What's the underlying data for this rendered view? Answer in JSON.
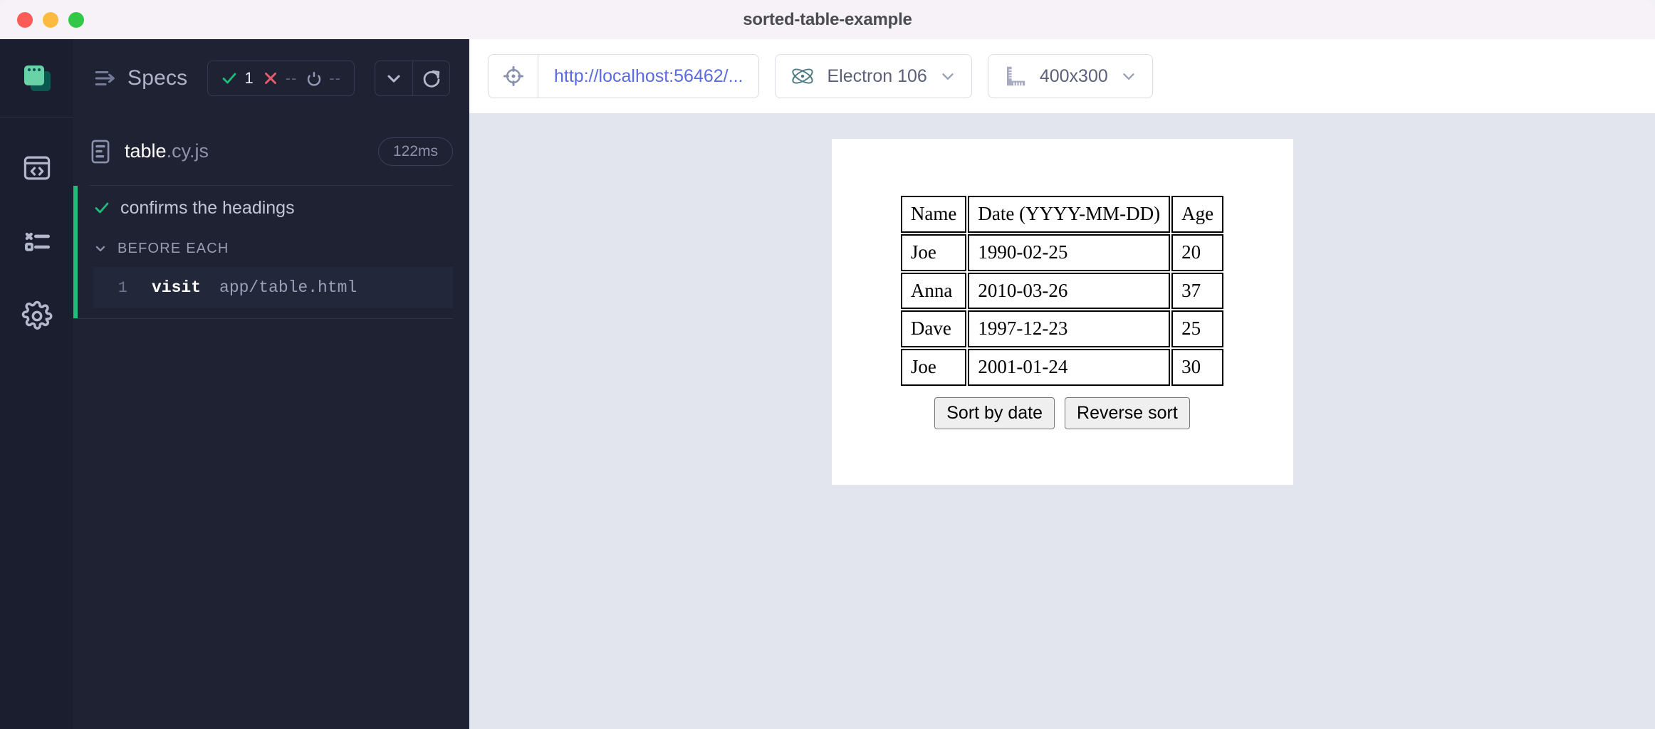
{
  "window": {
    "title": "sorted-table-example",
    "traffic_lights": [
      "close",
      "minimize",
      "zoom"
    ]
  },
  "rail": {
    "logo": "cypress-logo-icon",
    "items": [
      {
        "name": "specs-runner-icon",
        "icon": "browser-code-icon"
      },
      {
        "name": "test-results-icon",
        "icon": "checklist-icon"
      },
      {
        "name": "settings-icon",
        "icon": "gear-icon"
      }
    ]
  },
  "specs_panel": {
    "header_title": "Specs",
    "header_icon": "collapse-sidebar-icon",
    "stats": [
      {
        "icon": "check-icon",
        "value": "1",
        "color": "#1cbe79"
      },
      {
        "icon": "x-icon",
        "value": "--",
        "color": "#e45b6e"
      },
      {
        "icon": "pending-icon",
        "value": "--",
        "color": "#8e92ab"
      }
    ],
    "controls": [
      {
        "name": "chevron-down-button",
        "icon": "chevron-down-icon"
      },
      {
        "name": "refresh-button",
        "icon": "refresh-icon"
      }
    ],
    "spec_file": {
      "icon": "spec-file-icon",
      "base_name": "table",
      "extension": ".cy.js",
      "duration": "122ms"
    },
    "test": {
      "status_icon": "check-icon",
      "title": "confirms the headings",
      "hook": {
        "toggle_icon": "chevron-down-icon",
        "label": "BEFORE EACH"
      },
      "commands": [
        {
          "number": "1",
          "name": "visit",
          "argument": "app/table.html"
        }
      ]
    }
  },
  "aut_bar": {
    "selector_playground_icon": "crosshair-icon",
    "url": "http://localhost:56462/...",
    "browser": {
      "icon": "electron-icon",
      "label": "Electron 106",
      "chevron": "chevron-down-icon"
    },
    "viewport": {
      "icon": "ruler-icon",
      "label": "400x300",
      "chevron": "chevron-down-icon"
    }
  },
  "app_under_test": {
    "table": {
      "headers": [
        "Name",
        "Date (YYYY-MM-DD)",
        "Age"
      ],
      "rows": [
        [
          "Joe",
          "1990-02-25",
          "20"
        ],
        [
          "Anna",
          "2010-03-26",
          "37"
        ],
        [
          "Dave",
          "1997-12-23",
          "25"
        ],
        [
          "Joe",
          "2001-01-24",
          "30"
        ]
      ]
    },
    "buttons": [
      {
        "name": "sort-by-date-button",
        "label": "Sort by date"
      },
      {
        "name": "reverse-sort-button",
        "label": "Reverse sort"
      }
    ]
  },
  "colors": {
    "accent_green": "#1cbe79",
    "accent_red": "#e45b6e",
    "panel_bg": "#1f2233",
    "rail_bg": "#1b1e2e",
    "stage_bg": "#e2e5ee",
    "link": "#5a6ae0"
  }
}
